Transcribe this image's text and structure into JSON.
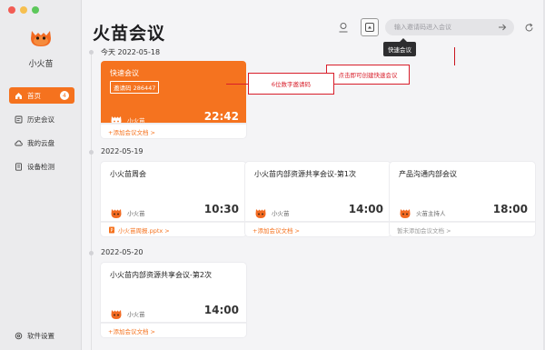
{
  "app": {
    "name": "小火苗"
  },
  "sidebar": {
    "items": [
      {
        "label": "首页",
        "badge": "4",
        "icon": "home-icon",
        "active": true
      },
      {
        "label": "历史会议",
        "icon": "history-icon"
      },
      {
        "label": "我的云盘",
        "icon": "cloud-icon"
      },
      {
        "label": "设备检测",
        "icon": "device-icon"
      }
    ],
    "settings_label": "软件设置"
  },
  "header": {
    "title": "火苗会议",
    "search_placeholder": "输入邀请码进入会议",
    "tooltip": "快速会议"
  },
  "annotations": {
    "create": "点击即可创建快速会议",
    "code": "6位数字邀请码"
  },
  "groups": [
    {
      "date": "今天 2022-05-18",
      "cards": [
        {
          "title": "快速会议",
          "code": "邀请码 286447",
          "host": "小火苗",
          "time": "22:42",
          "footer": "+添加会议文档 >",
          "highlight": true
        }
      ]
    },
    {
      "date": "2022-05-19",
      "cards": [
        {
          "title": "小火苗周会",
          "host": "小火苗",
          "time": "10:30",
          "footer": "小火苗周报.pptx >"
        },
        {
          "title": "小火苗内部资源共享会议-第1次",
          "host": "小火苗",
          "time": "14:00",
          "footer": "+添加会议文档 >"
        },
        {
          "title": "产品沟通内部会议",
          "host": "火苗主持人",
          "time": "18:00",
          "footer": "暂未添加会议文档 >"
        }
      ]
    },
    {
      "date": "2022-05-20",
      "cards": [
        {
          "title": "小火苗内部资源共享会议-第2次",
          "host": "小火苗",
          "time": "14:00",
          "footer": "+添加会议文档 >"
        }
      ]
    }
  ],
  "colors": {
    "accent": "#f5721e",
    "annotation": "#d81e2a"
  }
}
